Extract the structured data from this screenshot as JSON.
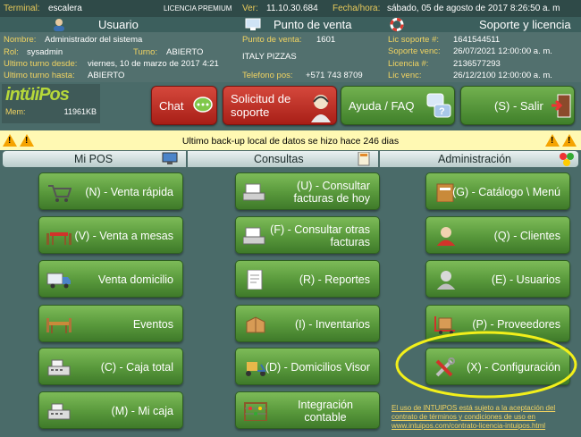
{
  "topbar": {
    "terminal_label": "Terminal:",
    "terminal_value": "escalera",
    "license_type": "LICENCIA PREMIUM",
    "ver_label": "Ver:",
    "ver_value": "11.10.30.684",
    "datetime_label": "Fecha/hora:",
    "datetime_value": "sábado, 05 de agosto de 2017 8:26:50 a. m"
  },
  "user_panel": {
    "title": "Usuario",
    "nombre_label": "Nombre:",
    "nombre_value": "Administrador del sistema",
    "rol_label": "Rol:",
    "rol_value": "sysadmin",
    "turno_label": "Turno:",
    "turno_value": "ABIERTO",
    "desde_label": "Ultimo turno desde:",
    "desde_value": "viernes, 10 de marzo de 2017 4:21",
    "hasta_label": "Ultimo turno hasta:",
    "hasta_value": "ABIERTO"
  },
  "pos_panel": {
    "title": "Punto de venta",
    "pv_label": "Punto de venta:",
    "pv_value": "1601",
    "name_value": "ITALY PIZZAS",
    "tel_label": "Telefono pos:",
    "tel_value": "+571 743 8709"
  },
  "support_panel": {
    "title": "Soporte y licencia",
    "lic_soporte_label": "Lic soporte #:",
    "lic_soporte_value": "1641544511",
    "soporte_venc_label": "Soporte venc:",
    "soporte_venc_value": "26/07/2021 12:00:00 a. m.",
    "licencia_label": "Licencia #:",
    "licencia_value": "2136577293",
    "lic_venc_label": "Lic venc:",
    "lic_venc_value": "26/12/2100 12:00:00 a. m."
  },
  "logo": {
    "text": "intüiPos",
    "mem_label": "Mem:",
    "mem_value": "11961KB"
  },
  "actions": {
    "chat": "Chat",
    "solicitud": "Solicitud de soporte",
    "ayuda": "Ayuda / FAQ",
    "salir": "(S) - Salir"
  },
  "warning": {
    "text": "Ultimo back-up local de datos se hizo hace 246 dias"
  },
  "sections": {
    "mipos": "Mi POS",
    "consultas": "Consultas",
    "admin": "Administración"
  },
  "mipos_buttons": [
    "(N) - Venta rápida",
    "(V) - Venta a mesas",
    "Venta domicilio",
    "Eventos",
    "(C) - Caja total",
    "(M) - Mi caja"
  ],
  "consultas_buttons": [
    "(U) - Consultar facturas de hoy",
    "(F) - Consultar otras facturas",
    "(R) - Reportes",
    "(I) - Inventarios",
    "(D) - Domicilios Visor",
    "Integración contable"
  ],
  "admin_buttons": [
    "(G) - Catálogo \\ Menú",
    "(Q) - Clientes",
    "(E) - Usuarios",
    "(P) - Proveedores",
    "(X) - Configuración"
  ],
  "license_text": "El uso de INTUIPOS está sujeto a la aceptación del contrato de términos y condiciones de uso en www.intuipos.com/contrato-licencia-intuipos.html",
  "colors": {
    "accent_green": "#58983b",
    "accent_red": "#c0362c",
    "warning_bg": "#fff9b3",
    "highlight_ring": "#f2ef1a"
  }
}
